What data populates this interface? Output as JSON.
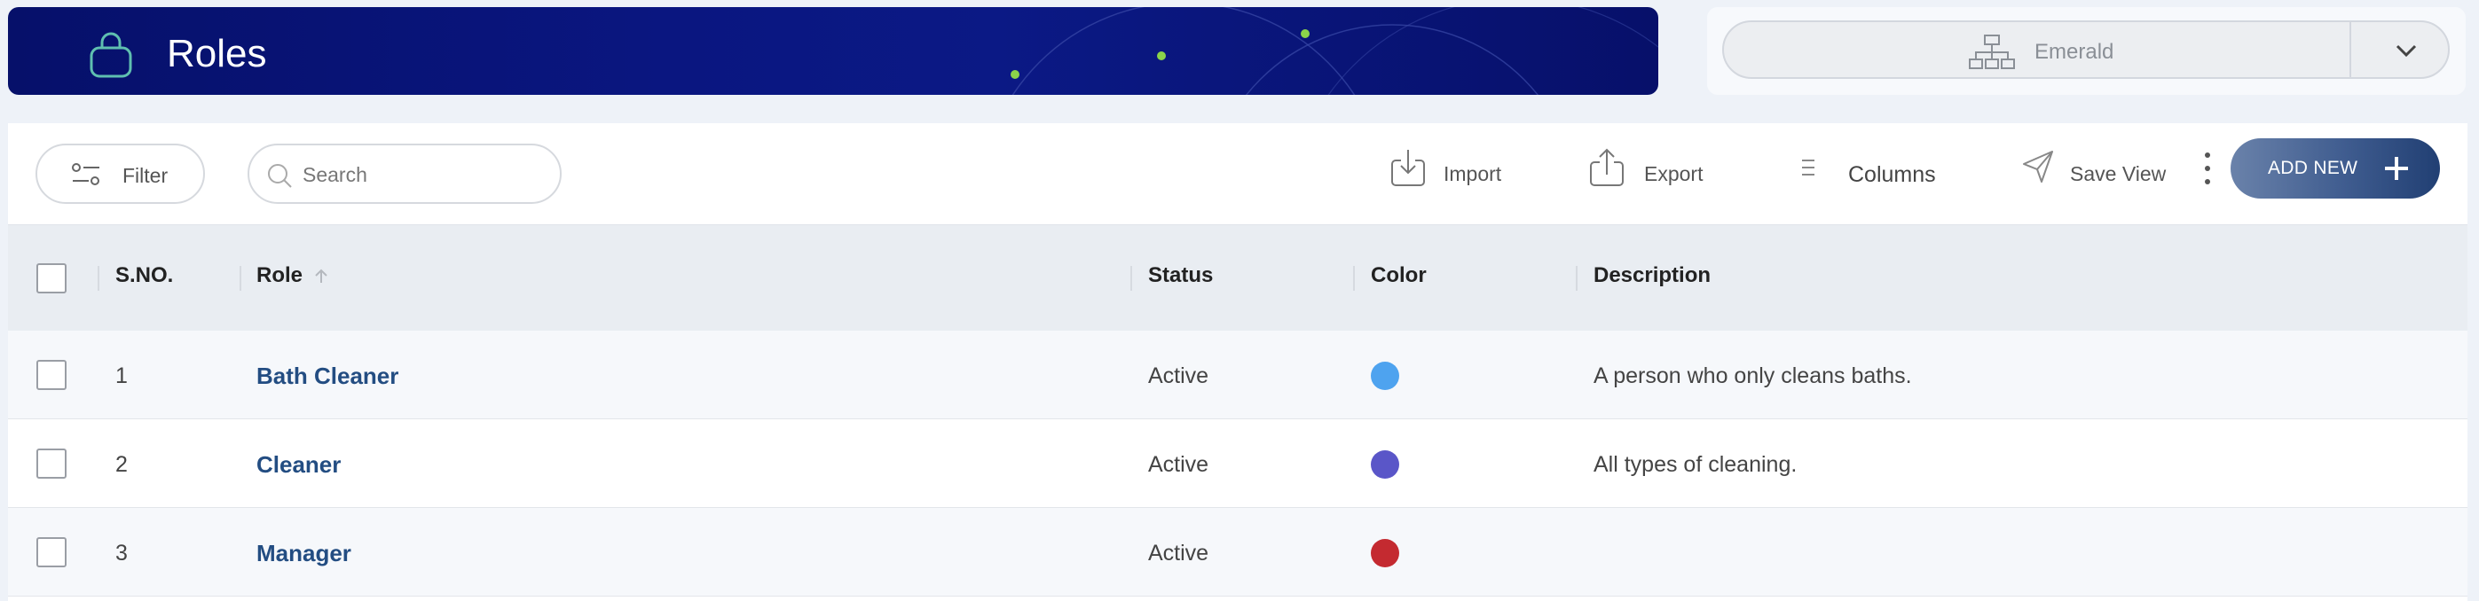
{
  "header": {
    "title": "Roles"
  },
  "org_selector": {
    "value": "Emerald"
  },
  "toolbar": {
    "filter_label": "Filter",
    "search_placeholder": "Search",
    "import_label": "Import",
    "export_label": "Export",
    "columns_label": "Columns",
    "save_view_label": "Save View",
    "add_new_label": "ADD NEW"
  },
  "table": {
    "headers": {
      "sno": "S.NO.",
      "role": "Role",
      "status": "Status",
      "color": "Color",
      "description": "Description"
    },
    "rows": [
      {
        "sno": "1",
        "role": "Bath Cleaner",
        "status": "Active",
        "color": "#4ea3ef",
        "description": "A person who only cleans baths."
      },
      {
        "sno": "2",
        "role": "Cleaner",
        "status": "Active",
        "color": "#5a56c8",
        "description": "All types of cleaning."
      },
      {
        "sno": "3",
        "role": "Manager",
        "status": "Active",
        "color": "#c42a30",
        "description": ""
      }
    ]
  },
  "colors": {
    "banner": "#0a1680",
    "accent_green": "#8bd34a",
    "role_link": "#234d82",
    "add_button": "#3f5c8f"
  }
}
